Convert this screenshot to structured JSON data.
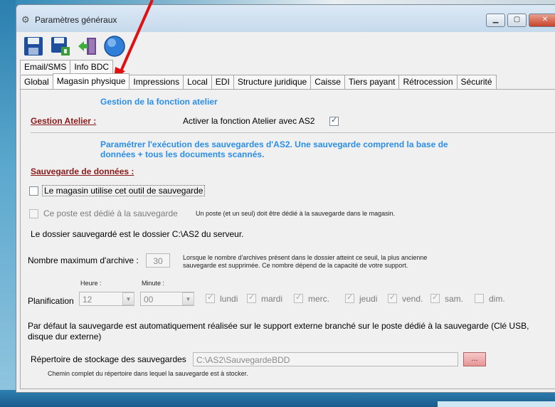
{
  "window": {
    "title": "Paramètres généraux"
  },
  "toolbar": {
    "icons": [
      "save-icon",
      "save-network-icon",
      "exit-door-icon",
      "help-globe-icon"
    ]
  },
  "tabs_row1": [
    "Email/SMS",
    "Info BDC"
  ],
  "tabs_row2": [
    "Global",
    "Magasin physique",
    "Impressions",
    "Local",
    "EDI",
    "Structure juridique",
    "Caisse",
    "Tiers payant",
    "Rétrocession",
    "Sécurité"
  ],
  "atelier": {
    "header": "Gestion de la fonction atelier",
    "section": "Gestion Atelier :",
    "enable_label": "Activer la fonction Atelier avec AS2",
    "enabled": true
  },
  "backup": {
    "header_line1": "Paramétrer l'exécution des sauvegardes d'AS2. Une sauvegarde comprend la base de",
    "header_line2": "données + tous les documents scannés.",
    "section": "Sauvegarde de données :",
    "use_tool_label": "Le magasin utilise cet outil de sauvegarde",
    "use_tool_checked": false,
    "dedicated_label": "Ce poste est dédié à la sauvegarde",
    "dedicated_checked": false,
    "dedicated_note": "Un poste (et un seul) doit être dédié à la sauvegarde dans le magasin.",
    "folder_info": "Le dossier sauvegardé est le dossier C:\\AS2 du serveur.",
    "max_archive_label": "Nombre maximum d'archive :",
    "max_archive_value": "30",
    "max_archive_note1": "Lorsque le nombre d'archives présent dans le dossier atteint ce seuil, la plus ancienne",
    "max_archive_note2": "sauvegarde est supprimée. Ce nombre dépend de la capacité de votre support.",
    "hour_label": "Heure :",
    "minute_label": "Minute :",
    "planning_label": "Planification",
    "hour_value": "12",
    "minute_value": "00",
    "days": [
      {
        "label": "lundi",
        "checked": true
      },
      {
        "label": "mardi",
        "checked": true
      },
      {
        "label": "merc.",
        "checked": true
      },
      {
        "label": "jeudi",
        "checked": true
      },
      {
        "label": "vend.",
        "checked": true
      },
      {
        "label": "sam.",
        "checked": true
      },
      {
        "label": "dim.",
        "checked": false
      }
    ],
    "default_info_line1": "Par défaut la sauvegarde est automatiquement réalisée sur le support externe branché sur le poste dédié à la sauvegarde (Clé USB,",
    "default_info_line2": "disque dur externe)",
    "storage_label": "Répertoire de stockage des sauvegardes",
    "storage_value": "C:\\AS2\\SauvegardeBDD",
    "browse_label": "...",
    "storage_note": "Chemin complet du répertoire dans lequel la sauvegarde est à stocker."
  }
}
